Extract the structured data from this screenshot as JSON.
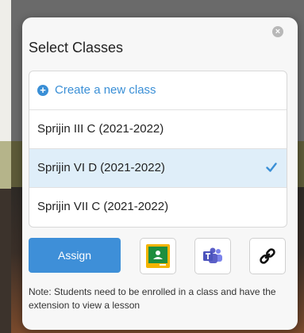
{
  "dialog": {
    "title": "Select Classes",
    "close_icon": "close-icon",
    "create_label": "Create a new class",
    "classes": [
      {
        "label": "Sprijin III C (2021-2022)",
        "selected": false
      },
      {
        "label": "Sprijin VI D (2021-2022)",
        "selected": true
      },
      {
        "label": "Sprijin VII C (2021-2022)",
        "selected": false
      }
    ],
    "assign_label": "Assign",
    "share_icons": [
      "google-classroom-icon",
      "microsoft-teams-icon",
      "link-icon"
    ],
    "note": "Note: Students need to be enrolled in a class and have the extension to view a lesson"
  },
  "colors": {
    "accent": "#3e8fd8",
    "selected_row": "#dfeef9",
    "classroom_green": "#1e8e3e",
    "classroom_yellow": "#f4b400",
    "teams_purple": "#5b5fc7"
  }
}
